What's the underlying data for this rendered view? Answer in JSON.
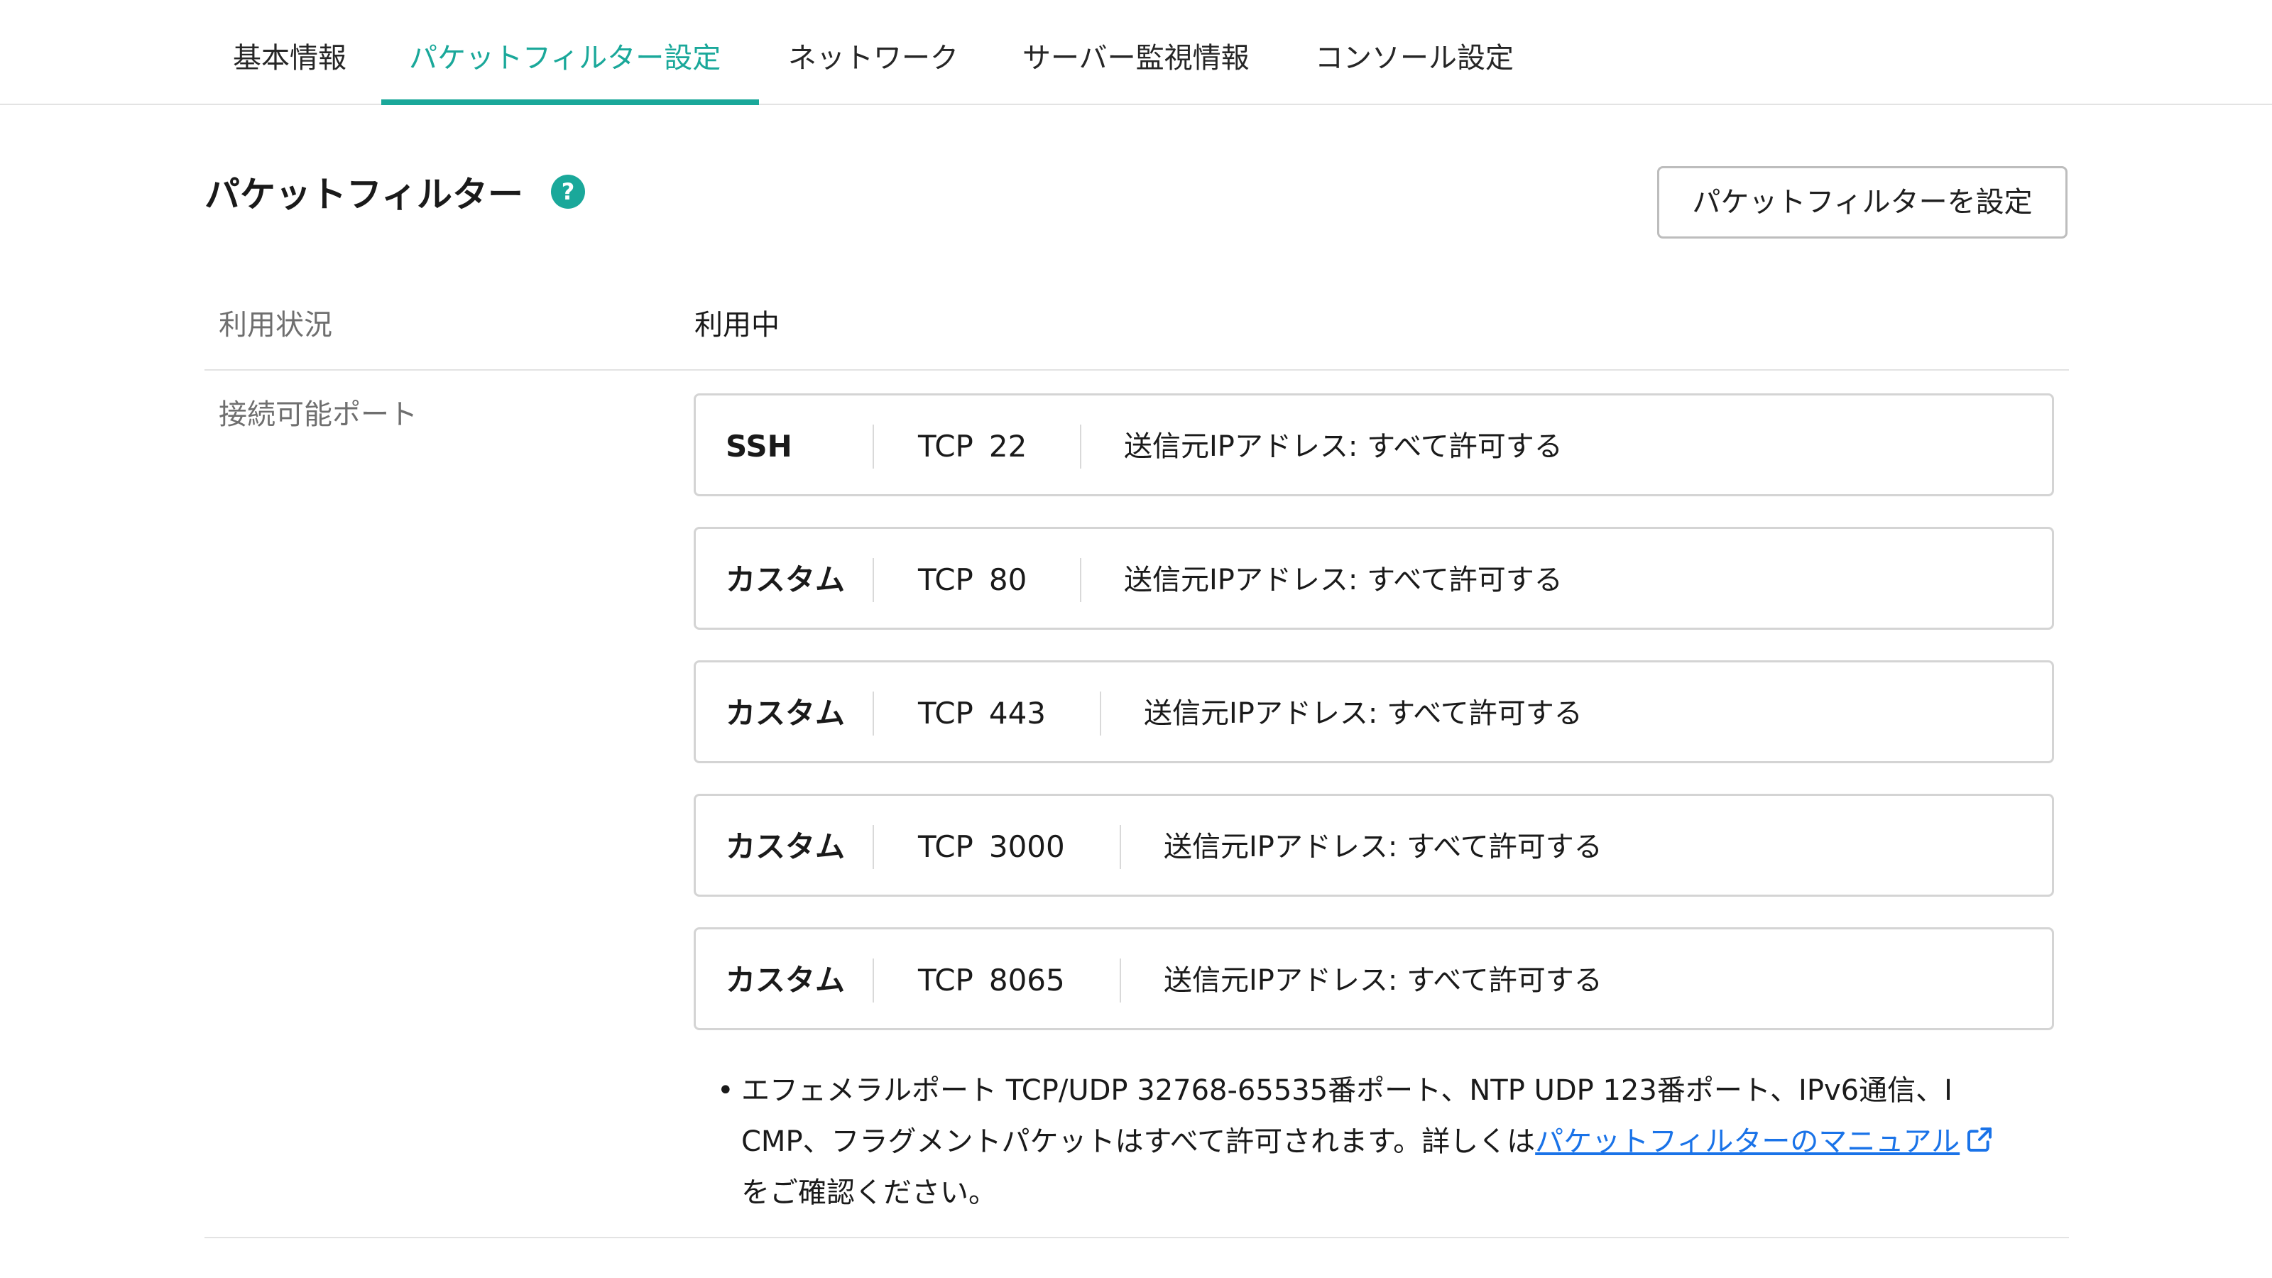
{
  "tabs": [
    {
      "label": "基本情報",
      "active": false
    },
    {
      "label": "パケットフィルター設定",
      "active": true
    },
    {
      "label": "ネットワーク",
      "active": false
    },
    {
      "label": "サーバー監視情報",
      "active": false
    },
    {
      "label": "コンソール設定",
      "active": false
    }
  ],
  "section": {
    "title": "パケットフィルター",
    "help_icon": "question-circle-icon",
    "button_label": "パケットフィルターを設定"
  },
  "usage": {
    "label": "利用状況",
    "value": "利用中"
  },
  "ports": {
    "label": "接続可能ポート",
    "rules": [
      {
        "name": "SSH",
        "protocol": "TCP",
        "port": "22",
        "source": "送信元IPアドレス: すべて許可する"
      },
      {
        "name": "カスタム",
        "protocol": "TCP",
        "port": "80",
        "source": "送信元IPアドレス: すべて許可する"
      },
      {
        "name": "カスタム",
        "protocol": "TCP",
        "port": "443",
        "source": "送信元IPアドレス: すべて許可する"
      },
      {
        "name": "カスタム",
        "protocol": "TCP",
        "port": "3000",
        "source": "送信元IPアドレス: すべて許可する"
      },
      {
        "name": "カスタム",
        "protocol": "TCP",
        "port": "8065",
        "source": "送信元IPアドレス: すべて許可する"
      }
    ]
  },
  "note": {
    "bullet": "•",
    "line1": "エフェメラルポート TCP/UDP 32768-65535番ポート、NTP UDP 123番ポート、IPv6通信、I",
    "line2_prefix": "CMP、フラグメントパケットはすべて許可されます。詳しくは",
    "link_text": "パケットフィルターのマニュアル",
    "link_icon": "external-link-icon",
    "line3": "をご確認ください。"
  },
  "colors": {
    "accent": "#1aa89a",
    "link": "#1a73e8",
    "border": "#d4d4d4",
    "label_text": "#6f6f6f"
  }
}
